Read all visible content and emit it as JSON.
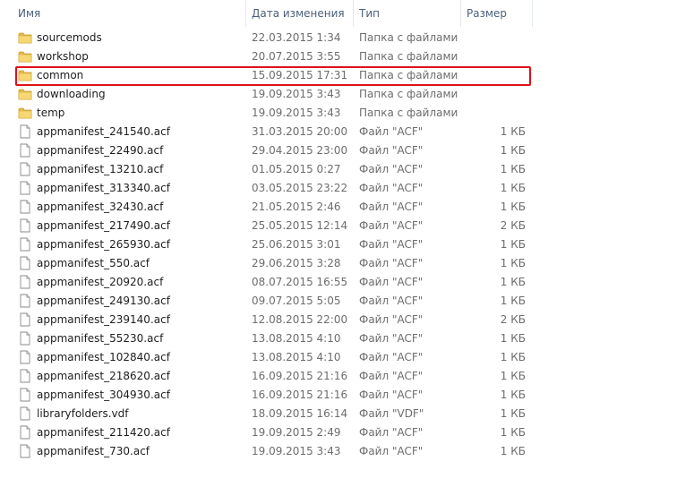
{
  "columns": {
    "name": "Имя",
    "date": "Дата изменения",
    "type": "Тип",
    "size": "Размер"
  },
  "colors": {
    "header_text": "#4c607a",
    "secondary_text": "#6d6d6d",
    "highlight_border": "#e0101a",
    "folder_yellow": "#f2c94c"
  },
  "files": [
    {
      "icon": "folder-icon",
      "name": "sourcemods",
      "date": "22.03.2015 1:34",
      "type": "Папка с файлами",
      "size": ""
    },
    {
      "icon": "folder-icon",
      "name": "workshop",
      "date": "20.07.2015 3:55",
      "type": "Папка с файлами",
      "size": ""
    },
    {
      "icon": "folder-icon",
      "name": "common",
      "date": "15.09.2015 17:31",
      "type": "Папка с файлами",
      "size": "",
      "highlighted": true
    },
    {
      "icon": "folder-icon",
      "name": "downloading",
      "date": "19.09.2015 3:43",
      "type": "Папка с файлами",
      "size": ""
    },
    {
      "icon": "folder-icon",
      "name": "temp",
      "date": "19.09.2015 3:43",
      "type": "Папка с файлами",
      "size": ""
    },
    {
      "icon": "file-icon",
      "name": "appmanifest_241540.acf",
      "date": "31.03.2015 20:00",
      "type": "Файл \"ACF\"",
      "size": "1 КБ"
    },
    {
      "icon": "file-icon",
      "name": "appmanifest_22490.acf",
      "date": "29.04.2015 23:00",
      "type": "Файл \"ACF\"",
      "size": "1 КБ"
    },
    {
      "icon": "file-icon",
      "name": "appmanifest_13210.acf",
      "date": "01.05.2015 0:27",
      "type": "Файл \"ACF\"",
      "size": "1 КБ"
    },
    {
      "icon": "file-icon",
      "name": "appmanifest_313340.acf",
      "date": "03.05.2015 23:22",
      "type": "Файл \"ACF\"",
      "size": "1 КБ"
    },
    {
      "icon": "file-icon",
      "name": "appmanifest_32430.acf",
      "date": "21.05.2015 2:46",
      "type": "Файл \"ACF\"",
      "size": "1 КБ"
    },
    {
      "icon": "file-icon",
      "name": "appmanifest_217490.acf",
      "date": "25.05.2015 12:14",
      "type": "Файл \"ACF\"",
      "size": "2 КБ"
    },
    {
      "icon": "file-icon",
      "name": "appmanifest_265930.acf",
      "date": "25.06.2015 3:01",
      "type": "Файл \"ACF\"",
      "size": "1 КБ"
    },
    {
      "icon": "file-icon",
      "name": "appmanifest_550.acf",
      "date": "29.06.2015 3:28",
      "type": "Файл \"ACF\"",
      "size": "1 КБ"
    },
    {
      "icon": "file-icon",
      "name": "appmanifest_20920.acf",
      "date": "08.07.2015 16:55",
      "type": "Файл \"ACF\"",
      "size": "1 КБ"
    },
    {
      "icon": "file-icon",
      "name": "appmanifest_249130.acf",
      "date": "09.07.2015 5:05",
      "type": "Файл \"ACF\"",
      "size": "1 КБ"
    },
    {
      "icon": "file-icon",
      "name": "appmanifest_239140.acf",
      "date": "12.08.2015 22:00",
      "type": "Файл \"ACF\"",
      "size": "2 КБ"
    },
    {
      "icon": "file-icon",
      "name": "appmanifest_55230.acf",
      "date": "13.08.2015 4:10",
      "type": "Файл \"ACF\"",
      "size": "1 КБ"
    },
    {
      "icon": "file-icon",
      "name": "appmanifest_102840.acf",
      "date": "13.08.2015 4:10",
      "type": "Файл \"ACF\"",
      "size": "1 КБ"
    },
    {
      "icon": "file-icon",
      "name": "appmanifest_218620.acf",
      "date": "16.09.2015 21:16",
      "type": "Файл \"ACF\"",
      "size": "1 КБ"
    },
    {
      "icon": "file-icon",
      "name": "appmanifest_304930.acf",
      "date": "16.09.2015 21:16",
      "type": "Файл \"ACF\"",
      "size": "1 КБ"
    },
    {
      "icon": "file-icon",
      "name": "libraryfolders.vdf",
      "date": "18.09.2015 16:14",
      "type": "Файл \"VDF\"",
      "size": "1 КБ"
    },
    {
      "icon": "file-icon",
      "name": "appmanifest_211420.acf",
      "date": "19.09.2015 2:49",
      "type": "Файл \"ACF\"",
      "size": "1 КБ"
    },
    {
      "icon": "file-icon",
      "name": "appmanifest_730.acf",
      "date": "19.09.2015 3:43",
      "type": "Файл \"ACF\"",
      "size": "1 КБ"
    }
  ]
}
